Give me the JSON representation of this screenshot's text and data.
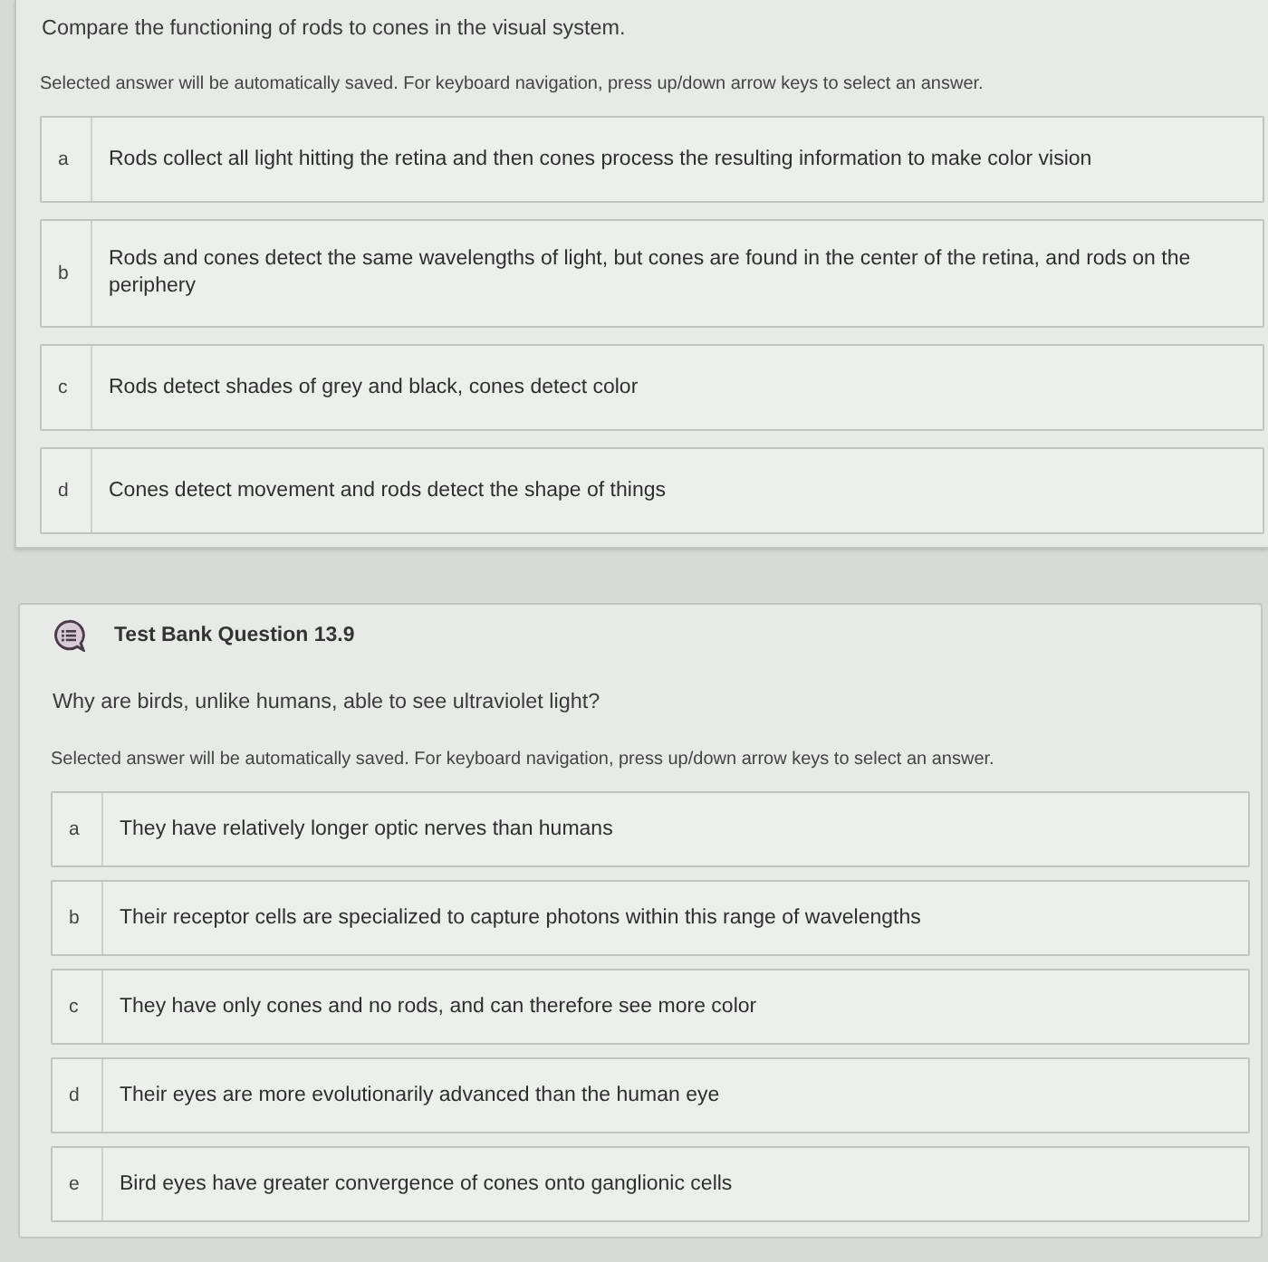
{
  "questions": [
    {
      "prompt": "Compare the functioning of rods to cones in the visual system.",
      "instruction": "Selected answer will be automatically saved. For keyboard navigation, press up/down arrow keys to select an answer.",
      "options": [
        {
          "letter": "a",
          "text": "Rods collect all light hitting the retina and then cones process the resulting information to make color vision",
          "selected": false
        },
        {
          "letter": "b",
          "text": "Rods and cones detect the same wavelengths of light, but cones are found in the center of the retina, and rods on the periphery",
          "selected": false
        },
        {
          "letter": "c",
          "text": "Rods detect shades of grey and black, cones detect color",
          "selected": false
        },
        {
          "letter": "d",
          "text": "Cones detect movement and rods detect the shape of things",
          "selected": false
        }
      ]
    },
    {
      "header": "Test Bank Question 13.9",
      "prompt": "Why are birds, unlike humans, able to see ultraviolet light?",
      "instruction": "Selected answer will be automatically saved. For keyboard navigation, press up/down arrow keys to select an answer.",
      "options": [
        {
          "letter": "a",
          "text": "They have relatively longer optic nerves than humans",
          "selected": false
        },
        {
          "letter": "b",
          "text": "Their receptor cells are specialized to capture photons within this range of wavelengths",
          "selected": false
        },
        {
          "letter": "c",
          "text": "They have only cones and no rods, and can therefore see more color",
          "selected": false
        },
        {
          "letter": "d",
          "text": "Their eyes are more evolutionarily advanced than the human eye",
          "selected": false
        },
        {
          "letter": "e",
          "text": "Bird eyes have greater convergence of cones onto ganglionic cells",
          "selected": false
        }
      ]
    }
  ]
}
